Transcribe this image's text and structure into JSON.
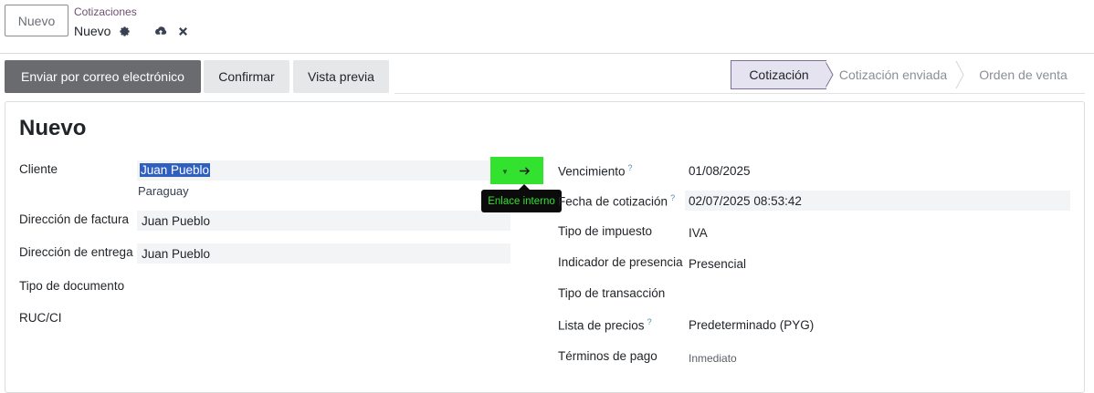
{
  "control_panel": {
    "new_button": "Nuevo",
    "breadcrumb": "Cotizaciones",
    "record_name": "Nuevo",
    "icons": [
      "gear-icon",
      "cloud-upload-icon",
      "close-icon"
    ]
  },
  "actions": {
    "send_email": "Enviar por correo electrónico",
    "confirm": "Confirmar",
    "preview": "Vista previa"
  },
  "statusbar": {
    "stages": [
      "Cotización",
      "Cotización enviada",
      "Orden de venta"
    ],
    "active": "Cotización"
  },
  "form": {
    "title": "Nuevo",
    "left": {
      "cliente_label": "Cliente",
      "cliente_value": "Juan Pueblo",
      "cliente_country": "Paraguay",
      "factura_label": "Dirección de factura",
      "factura_value": "Juan Pueblo",
      "entrega_label": "Dirección de entrega",
      "entrega_value": "Juan Pueblo",
      "tipo_doc_label": "Tipo de documento",
      "ruc_label": "RUC/CI"
    },
    "right": {
      "vencimiento_label": "Vencimiento",
      "vencimiento_value": "01/08/2025",
      "fecha_label": "Fecha de cotización",
      "fecha_value": "02/07/2025 08:53:42",
      "impuesto_label": "Tipo de impuesto",
      "impuesto_value": "IVA",
      "presencia_label": "Indicador de presencia",
      "presencia_value": "Presencial",
      "transaccion_label": "Tipo de transacción",
      "precios_label": "Lista de precios",
      "precios_value": "Predeterminado (PYG)",
      "pago_label": "Términos de pago",
      "pago_value": "Inmediato"
    },
    "help_mark": "?",
    "tooltip": "Enlace interno"
  }
}
